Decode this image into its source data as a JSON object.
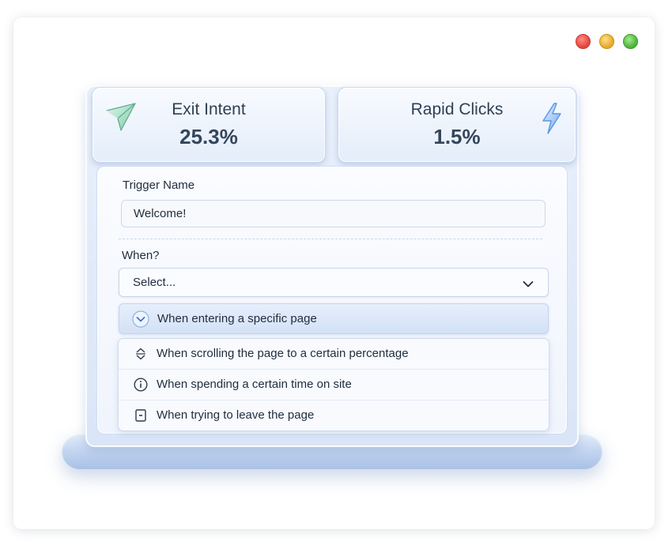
{
  "stats": [
    {
      "title": "Exit Intent",
      "value": "25.3%",
      "icon": "paper-plane-icon"
    },
    {
      "title": "Rapid Clicks",
      "value": "1.5%",
      "icon": "lightning-icon"
    }
  ],
  "form": {
    "trigger_name_label": "Trigger Name",
    "trigger_name_value": "Welcome!",
    "when_label": "When?",
    "select_value": "Select...",
    "options": [
      {
        "label": "When entering a specific page",
        "icon": "chevron-circle-icon",
        "selected": true
      },
      {
        "label": "When scrolling the page to a certain percentage",
        "icon": "scroll-icon"
      },
      {
        "label": "When spending a certain time on site",
        "icon": "info-icon"
      },
      {
        "label": "When trying to leave the page",
        "icon": "exit-icon"
      }
    ]
  },
  "colors": {
    "accent": "#4a90e2",
    "text": "#1f2d3d",
    "panel": "#d9e5f7"
  }
}
